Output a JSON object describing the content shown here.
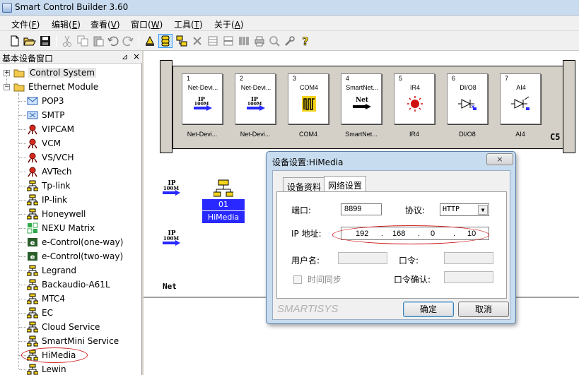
{
  "window": {
    "title": "Smart Control Builder 3.60"
  },
  "menu": [
    {
      "label": "文件(F)",
      "underline": "F"
    },
    {
      "label": "编辑(E)",
      "underline": "E"
    },
    {
      "label": "查看(V)",
      "underline": "V"
    },
    {
      "label": "窗口(W)",
      "underline": "W"
    },
    {
      "label": "工具(T)",
      "underline": "T"
    },
    {
      "label": "关于(A)",
      "underline": "A"
    }
  ],
  "toolbar": {
    "icons": [
      "new-file-icon",
      "open-folder-icon",
      "save-icon",
      "cut-icon",
      "copy-icon",
      "paste-icon",
      "undo-icon",
      "redo-icon",
      "bell-icon",
      "database-icon",
      "network-icon",
      "delete-icon",
      "panel-icon",
      "panel2-icon",
      "barcode-icon",
      "print-icon",
      "zoom-icon",
      "tools-icon",
      "help-icon"
    ]
  },
  "left_panel": {
    "title": "基本设备窗口",
    "pin": "ㄗ",
    "close": "×",
    "tree": [
      {
        "label": "Control System",
        "level": 0,
        "icon": "folder-icon",
        "expander": "+"
      },
      {
        "label": "Ethernet Module",
        "level": 0,
        "icon": "folder-icon",
        "expander": "−"
      },
      {
        "label": "POP3",
        "level": 1,
        "icon": "mail-icon"
      },
      {
        "label": "SMTP",
        "level": 1,
        "icon": "mail-x-icon"
      },
      {
        "label": "VIPCAM",
        "level": 1,
        "icon": "camera-icon"
      },
      {
        "label": "VCM",
        "level": 1,
        "icon": "camera-icon"
      },
      {
        "label": "VS/VCH",
        "level": 1,
        "icon": "camera-icon"
      },
      {
        "label": "AVTech",
        "level": 1,
        "icon": "camera-icon"
      },
      {
        "label": "Tp-link",
        "level": 1,
        "icon": "network-device-icon"
      },
      {
        "label": "IP-link",
        "level": 1,
        "icon": "network-device-icon"
      },
      {
        "label": "Honeywell",
        "level": 1,
        "icon": "network-device-icon"
      },
      {
        "label": "NEXU Matrix",
        "level": 1,
        "icon": "matrix-icon"
      },
      {
        "label": "e-Control(one-way)",
        "level": 1,
        "icon": "e-control-icon"
      },
      {
        "label": "e-Control(two-way)",
        "level": 1,
        "icon": "e-control-icon"
      },
      {
        "label": "Legrand",
        "level": 1,
        "icon": "network-device-icon"
      },
      {
        "label": "Backaudio-A61L",
        "level": 1,
        "icon": "network-device-icon"
      },
      {
        "label": "MTC4",
        "level": 1,
        "icon": "network-device-icon"
      },
      {
        "label": "EC",
        "level": 1,
        "icon": "network-device-icon"
      },
      {
        "label": "Cloud Service",
        "level": 1,
        "icon": "network-device-icon"
      },
      {
        "label": "SmartMini Service",
        "level": 1,
        "icon": "network-device-icon"
      },
      {
        "label": "HiMedia",
        "level": 1,
        "icon": "network-device-icon",
        "highlighted": true
      },
      {
        "label": "Lewin",
        "level": 1,
        "icon": "network-device-icon"
      }
    ]
  },
  "rack": {
    "label": "C5",
    "cards": [
      {
        "slot": "1",
        "name": "Net-Devi...",
        "label": "Net-Devi...",
        "icon": "ip-100m-icon"
      },
      {
        "slot": "2",
        "name": "Net-Devi...",
        "label": "Net-Devi...",
        "icon": "ip-100m-icon"
      },
      {
        "slot": "3",
        "name": "COM4",
        "label": "COM4",
        "icon": "com-port-icon"
      },
      {
        "slot": "4",
        "name": "SmartNet...",
        "label": "SmartNet...",
        "icon": "net-arrow-icon"
      },
      {
        "slot": "5",
        "name": "IR4",
        "label": "IR4",
        "icon": "ir-icon"
      },
      {
        "slot": "6",
        "name": "DI/O8",
        "label": "DI/O8",
        "icon": "dio-icon"
      },
      {
        "slot": "7",
        "name": "AI4",
        "label": "AI4",
        "icon": "ai-icon"
      }
    ]
  },
  "canvas": {
    "ip_logo_text": [
      "IP",
      "100M"
    ],
    "device": {
      "number": "01",
      "name": "HiMedia"
    },
    "net_label": "Net"
  },
  "dialog": {
    "title": "设备设置:HiMedia",
    "close": "×",
    "tabs": [
      "设备资料",
      "网络设置"
    ],
    "active_tab": 1,
    "port_label": "端口:",
    "port_value": "8899",
    "protocol_label": "协议:",
    "protocol_value": "HTTP",
    "ip_label": "IP 地址:",
    "ip": [
      "192",
      "168",
      "0",
      "10"
    ],
    "username_label": "用户名:",
    "username_value": "",
    "password_label": "口令:",
    "password_value": "",
    "time_sync_label": "时间同步",
    "confirm_password_label": "口令确认:",
    "confirm_password_value": "",
    "watermark": "SMARTISYS",
    "ok_label": "确定",
    "cancel_label": "取消"
  },
  "colors": {
    "highlight_ellipse": "#d02020",
    "device_blue": "#2828ff",
    "dialog_frame": "#c7dcef"
  }
}
